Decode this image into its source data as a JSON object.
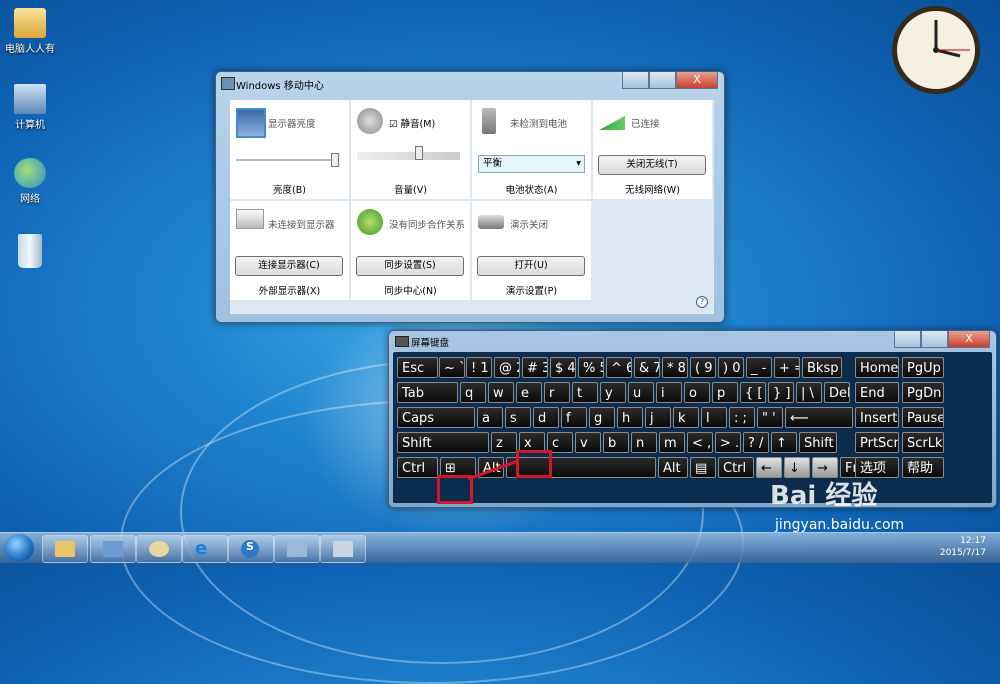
{
  "desktop": {
    "icons": [
      "电脑人人有",
      "计算机",
      "网络",
      ""
    ]
  },
  "mobility_center": {
    "title": "Windows 移动中心",
    "close": "X",
    "tiles": [
      {
        "label": "显示器亮度",
        "footer": "亮度(B)",
        "slider": 0.95
      },
      {
        "label": "静音(M)",
        "footer": "音量(V)",
        "checked": true,
        "slider": 0.55
      },
      {
        "label": "未检测到电池",
        "footer": "电池状态(A)",
        "select": "平衡"
      },
      {
        "label": "已连接",
        "footer": "无线网络(W)",
        "button": "关闭无线(T)"
      },
      {
        "label": "未连接到显示器",
        "footer": "外部显示器(X)",
        "button": "连接显示器(C)"
      },
      {
        "label": "没有同步合作关系",
        "footer": "同步中心(N)",
        "button": "同步设置(S)"
      },
      {
        "label": "演示关闭",
        "footer": "演示设置(P)",
        "button": "打开(U)"
      }
    ],
    "help": "?"
  },
  "osk": {
    "title": "屏幕键盘",
    "rows": [
      [
        "Esc",
        "~ `",
        "! 1",
        "@ 2",
        "# 3",
        "$ 4",
        "% 5",
        "^ 6",
        "& 7",
        "* 8",
        "( 9",
        ") 0",
        "_ -",
        "+ =",
        "Bksp",
        "Home",
        "PgUp"
      ],
      [
        "Tab",
        "q",
        "w",
        "e",
        "r",
        "t",
        "y",
        "u",
        "i",
        "o",
        "p",
        "{ [",
        "} ]",
        "| \\",
        "Del",
        "End",
        "PgDn"
      ],
      [
        "Caps",
        "a",
        "s",
        "d",
        "f",
        "g",
        "h",
        "j",
        "k",
        "l",
        ": ;",
        "\" '",
        "⟵",
        "Insert",
        "Pause"
      ],
      [
        "Shift",
        "z",
        "x",
        "c",
        "v",
        "b",
        "n",
        "m",
        "< ,",
        "> .",
        "? /",
        "↑",
        "Shift",
        "PrtScn",
        "ScrLk"
      ],
      [
        "Ctrl",
        "⊞",
        "Alt",
        "",
        "Alt",
        "▤",
        "Ctrl",
        "←",
        "↓",
        "→",
        "Fn",
        "选项",
        "帮助"
      ]
    ]
  },
  "taskbar": {
    "time": "12:17",
    "date": "2015/7/17"
  },
  "watermark": {
    "brand": "Bai 经验",
    "url": "jingyan.baidu.com"
  }
}
